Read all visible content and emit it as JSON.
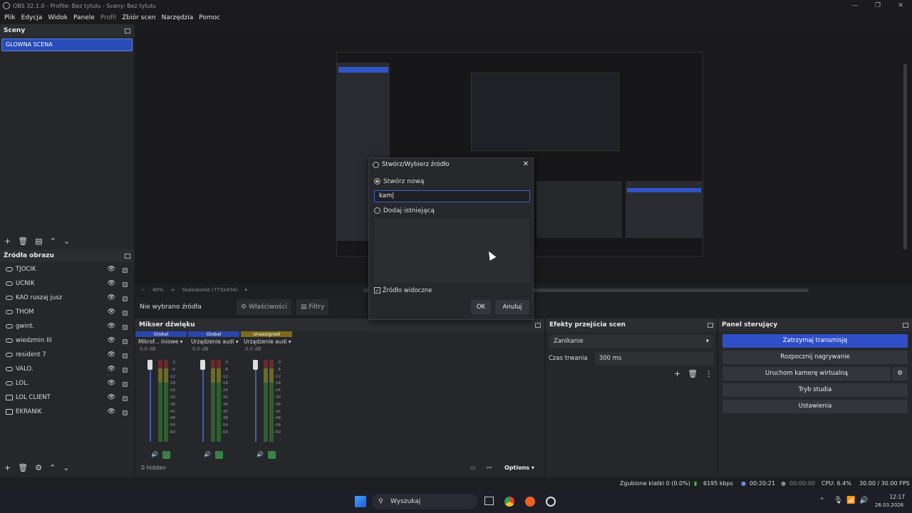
{
  "window": {
    "title": "OBS 32.1.0 - Profile: Bez tytułu - Sceny: Bez tytułu"
  },
  "menu": [
    {
      "label": "Plik",
      "dim": false
    },
    {
      "label": "Edycja",
      "dim": false
    },
    {
      "label": "Widok",
      "dim": false
    },
    {
      "label": "Panele",
      "dim": false
    },
    {
      "label": "Profil",
      "dim": true
    },
    {
      "label": "Zbiór scen",
      "dim": false
    },
    {
      "label": "Narzędzia",
      "dim": false
    },
    {
      "label": "Pomoc",
      "dim": false
    }
  ],
  "scenes": {
    "title": "Sceny",
    "items": [
      "GLOWNA SCENA"
    ]
  },
  "sources": {
    "title": "Źródła obrazu",
    "items": [
      {
        "label": "TJOCIK",
        "icon": "gamepad-icon"
      },
      {
        "label": "UCNIK",
        "icon": "gamepad-icon"
      },
      {
        "label": "KAO ruszaj jusz",
        "icon": "gamepad-icon"
      },
      {
        "label": "THOM",
        "icon": "gamepad-icon"
      },
      {
        "label": "gwint.",
        "icon": "gamepad-icon"
      },
      {
        "label": "wiedzmin III",
        "icon": "gamepad-icon"
      },
      {
        "label": "resident 7",
        "icon": "gamepad-icon"
      },
      {
        "label": "VALO.",
        "icon": "gamepad-icon"
      },
      {
        "label": "LOL.",
        "icon": "gamepad-icon"
      },
      {
        "label": "LOL CLIENT",
        "icon": "window-icon"
      },
      {
        "label": "EKRANIK",
        "icon": "monitor-icon"
      }
    ]
  },
  "preview": {
    "zoom": "40%",
    "scaling": "Skalowanie (773x434)"
  },
  "context": {
    "no_source": "Nie wybrano źródła",
    "properties": "Właściwości",
    "filters": "Filtry"
  },
  "mixer": {
    "title": "Mikser dźwięku",
    "strips": [
      {
        "bus": "Global",
        "bus_color": "#2a46a8",
        "device": "Mikrof... iniowe",
        "db": "0.0 dB"
      },
      {
        "bus": "Global",
        "bus_color": "#2a46a8",
        "device": "Urządzenie audi",
        "db": "0.0 dB"
      },
      {
        "bus": "Unassigned",
        "bus_color": "#7a6a1a",
        "device": "Urządzenie audi",
        "db": "0.0 dB"
      }
    ],
    "ticks": [
      "0",
      "-6",
      "-12",
      "-18",
      "-24",
      "-30",
      "-36",
      "-42",
      "-48",
      "-54",
      "-60"
    ],
    "hidden": "0 hidden",
    "options": "Options"
  },
  "transitions": {
    "title": "Efekty przejścia scen",
    "selected": "Zanikanie",
    "duration_label": "Czas trwania",
    "duration_value": "300 ms"
  },
  "controls": {
    "title": "Panel sterujący",
    "buttons": [
      "Zatrzymaj transmisję",
      "Rozpocznij nagrywanie",
      "Uruchom kamerę wirtualną",
      "Tryb studia",
      "Ustawienia"
    ]
  },
  "status": {
    "dropped": "Zgubione klatki 0 (0.0%)",
    "bitrate": "6195 kbps",
    "stream_time": "00:20:21",
    "rec_time": "00:00:00",
    "cpu": "CPU: 6.4%",
    "fps": "30.00 / 30.00 FPS"
  },
  "taskbar": {
    "search": "Wyszukaj",
    "time": "12:17",
    "date": "26.03.2026"
  },
  "dialog": {
    "title": "Stwórz/Wybierz źródło",
    "create_new": "Stwórz nową",
    "name_value": "kam",
    "add_existing": "Dodaj istniejącą",
    "visible_label": "Źródło widoczne",
    "ok": "OK",
    "cancel": "Anuluj"
  },
  "colors": {
    "accent": "#2f4fc8",
    "scene_selected": "#284cb8"
  }
}
